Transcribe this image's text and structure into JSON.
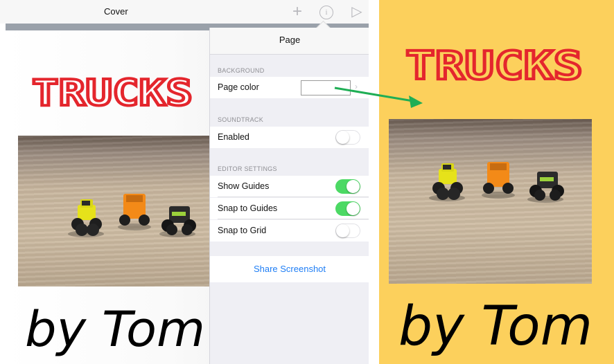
{
  "topbar": {
    "title": "Cover",
    "add_icon": "plus-icon",
    "info_icon": "info-icon",
    "play_icon": "play-icon"
  },
  "page": {
    "title_art": "TRUCKS",
    "signature": "by Tom",
    "title_color": "#e4262d"
  },
  "popover": {
    "title": "Page",
    "sections": {
      "background": "BACKGROUND",
      "soundtrack": "SOUNDTRACK",
      "editor": "EDITOR SETTINGS"
    },
    "rows": {
      "page_color": "Page color",
      "enabled": "Enabled",
      "show_guides": "Show Guides",
      "snap_guides": "Snap to Guides",
      "snap_grid": "Snap to Grid"
    },
    "toggles": {
      "enabled": false,
      "show_guides": true,
      "snap_guides": true,
      "snap_grid": false
    },
    "share_label": "Share Screenshot"
  },
  "result": {
    "background_color": "#fcd05c",
    "title_art": "TRUCKS",
    "signature": "by Tom"
  },
  "colors": {
    "accent_green": "#4cd964",
    "link_blue": "#1f7ef5",
    "arrow_green": "#1fae55"
  }
}
